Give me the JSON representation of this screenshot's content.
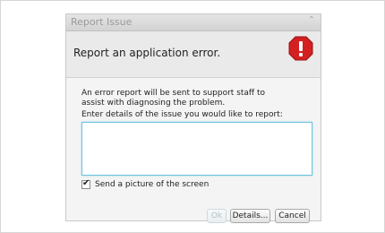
{
  "dialog": {
    "title": "Report Issue",
    "header_text": "Report an application error.",
    "header_icon": "error-stop-icon",
    "message": "An error report will be sent to support staff to assist with diagnosing the problem.",
    "prompt": "Enter details of the issue you would like to report:",
    "details_value": "",
    "checkbox": {
      "label": "Send a picture of the screen",
      "checked": true
    },
    "buttons": {
      "ok": "Ok",
      "details": "Details...",
      "cancel": "Cancel"
    }
  },
  "colors": {
    "accent": "#6ec4de",
    "error_red": "#d32020",
    "window_bg": "#f4f4f4"
  }
}
